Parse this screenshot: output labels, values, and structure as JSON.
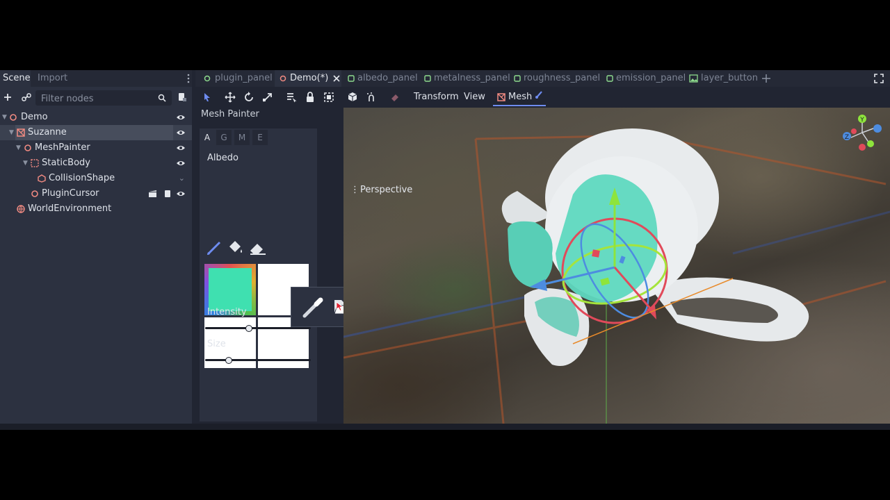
{
  "scene_dock": {
    "tabs": [
      "Scene",
      "Import"
    ],
    "filter_placeholder": "Filter nodes",
    "nodes": [
      {
        "label": "Demo",
        "icon": "node3d-icon",
        "color": "#f28b82"
      },
      {
        "label": "Suzanne",
        "icon": "mesh-instance-icon",
        "color": "#f28b82",
        "selected": true
      },
      {
        "label": "MeshPainter",
        "icon": "node3d-icon",
        "color": "#f28b82"
      },
      {
        "label": "StaticBody",
        "icon": "static-body-icon",
        "color": "#f28b82"
      },
      {
        "label": "CollisionShape",
        "icon": "collision-shape-icon",
        "color": "#f28b82"
      },
      {
        "label": "PluginCursor",
        "icon": "node3d-icon",
        "color": "#f28b82"
      },
      {
        "label": "WorldEnvironment",
        "icon": "world-environment-icon",
        "color": "#f28b82"
      }
    ]
  },
  "editor_tabs": [
    {
      "label": "plugin_panel"
    },
    {
      "label": "Demo(*)",
      "active": true
    },
    {
      "label": "albedo_panel"
    },
    {
      "label": "metalness_panel"
    },
    {
      "label": "roughness_panel"
    },
    {
      "label": "emission_panel"
    },
    {
      "label": "layer_button"
    }
  ],
  "toolbar": {
    "transform_label": "Transform",
    "view_label": "View",
    "mesh_label": "Mesh"
  },
  "mesh_painter": {
    "title": "Mesh Painter",
    "channel_tabs": [
      "A",
      "G",
      "M",
      "E"
    ],
    "section_label": "Albedo",
    "color_swatch": "#3fe0b0",
    "intensity_label": "Intensity",
    "intensity_value": 0.41,
    "size_label": "Size",
    "size_value": 0.22
  },
  "viewport": {
    "mode_label": "Perspective",
    "gizmo_axes": [
      "Y",
      "Z"
    ]
  },
  "colors": {
    "accent": "#6e8cf0",
    "node_icon": "#f28b82",
    "panel": "#2c3140",
    "background": "#212532"
  }
}
